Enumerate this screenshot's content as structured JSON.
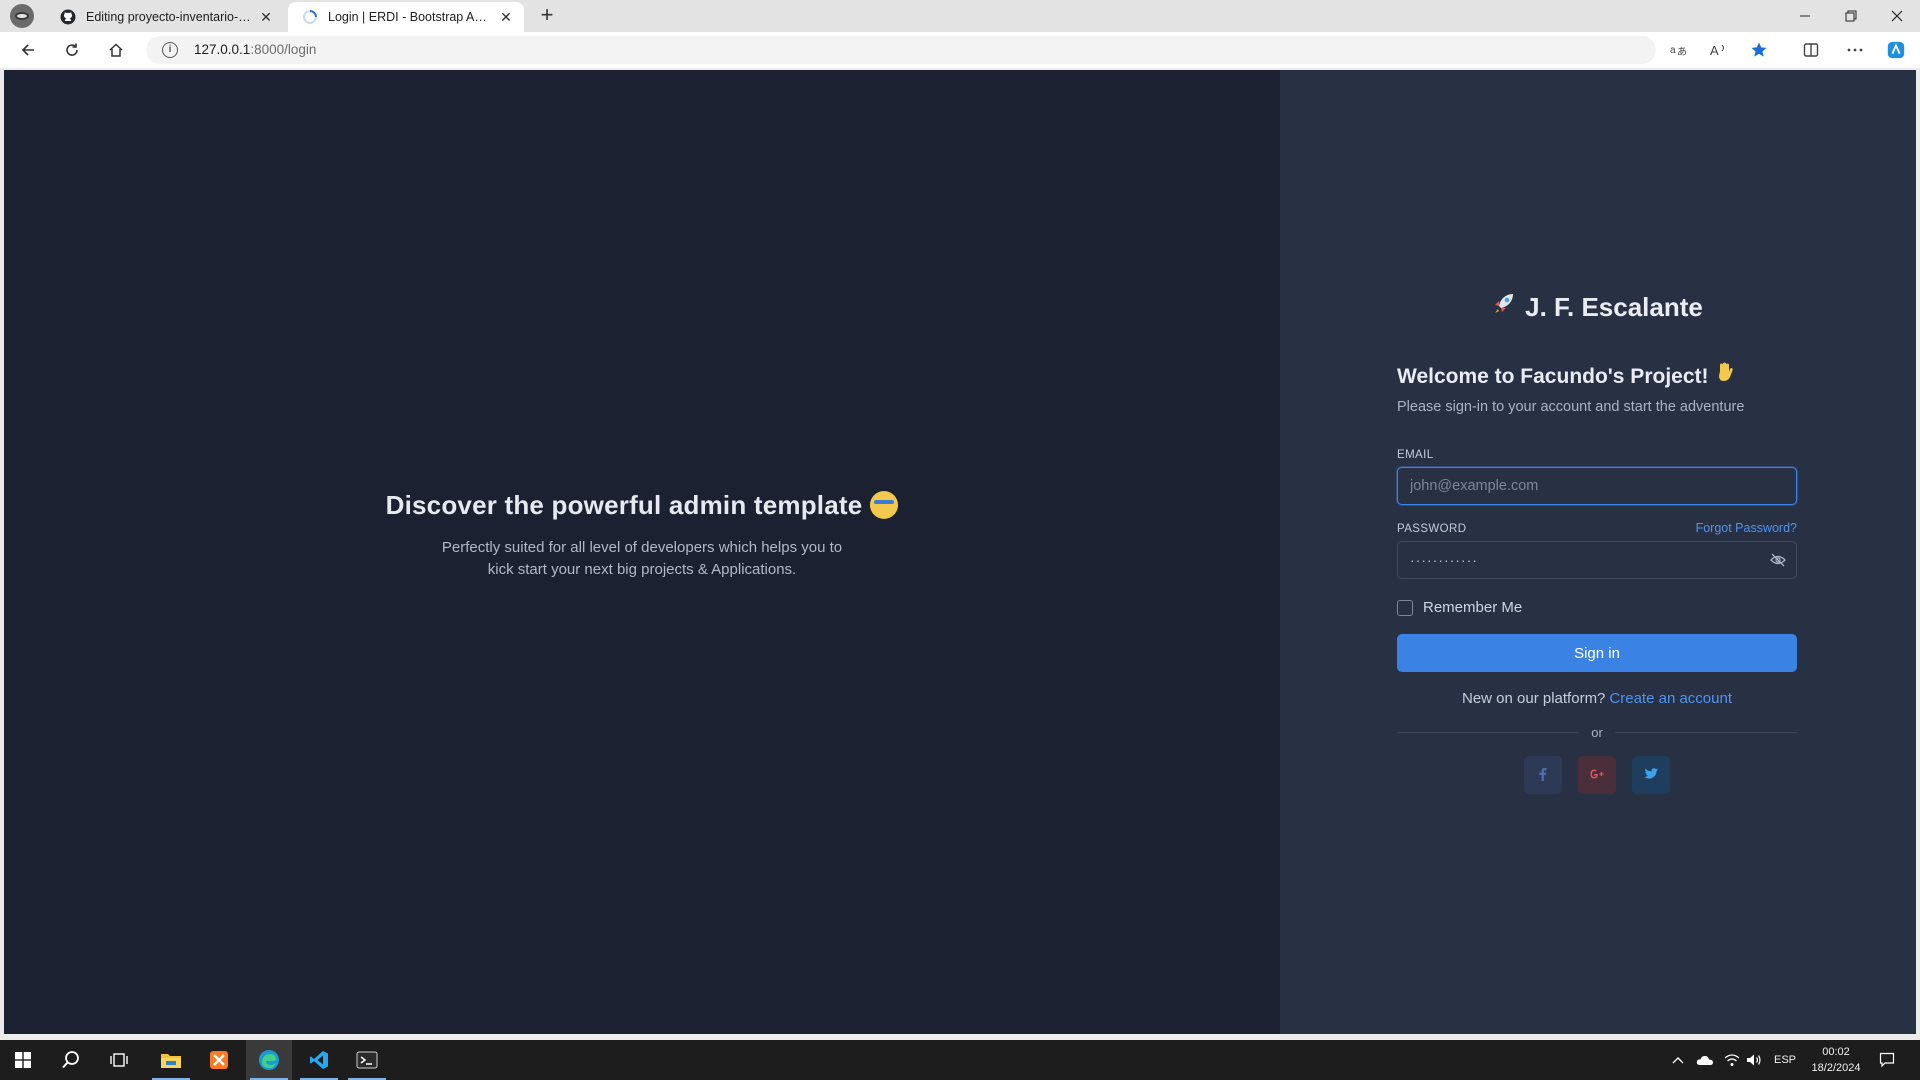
{
  "browser": {
    "tabs": [
      {
        "title": "Editing proyecto-inventario-de-e",
        "active": false,
        "icon": "github-icon"
      },
      {
        "title": "Login | ERDI - Bootstrap Admin T",
        "active": true,
        "icon": "loading-icon"
      }
    ],
    "address": {
      "host": "127.0.0.1",
      "rest": ":8000/login"
    }
  },
  "left": {
    "title": "Discover the powerful admin template",
    "subtitle": "Perfectly suited for all level of developers which helps you to kick start your next big projects & Applications."
  },
  "login": {
    "brand": "J. F. Escalante",
    "welcome": "Welcome to Facundo's Project!",
    "intro": "Please sign-in to your account and start the adventure",
    "email_label": "EMAIL",
    "email_placeholder": "john@example.com",
    "password_label": "PASSWORD",
    "forgot": "Forgot Password?",
    "password_mask": "············",
    "remember": "Remember Me",
    "signin": "Sign in",
    "signup_prompt": "New on our platform?",
    "signup_link": "Create an account",
    "divider": "or",
    "socials": [
      "facebook-icon",
      "google-plus-icon",
      "twitter-icon"
    ]
  },
  "taskbar": {
    "language": "ESP",
    "time": "00:02",
    "date": "18/2/2024"
  },
  "colors": {
    "left_bg": "#1b2130",
    "right_bg": "#283144",
    "primary": "#3a82e4",
    "link": "#4f93f0"
  }
}
